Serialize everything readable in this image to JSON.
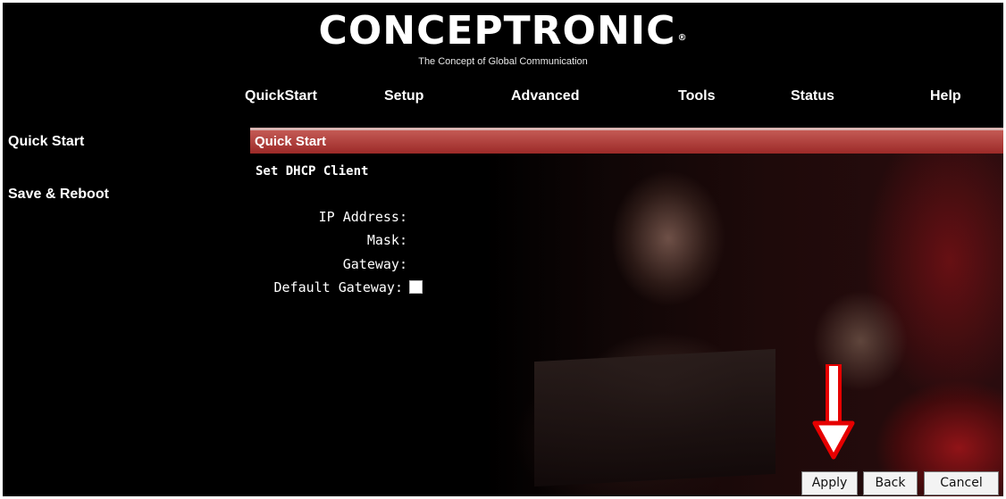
{
  "header": {
    "brand": "CONCEPTRONIC",
    "registered_mark": "®",
    "tagline": "The Concept of Global Communication"
  },
  "nav": {
    "items": [
      {
        "label": "QuickStart"
      },
      {
        "label": "Setup"
      },
      {
        "label": "Advanced"
      },
      {
        "label": "Tools"
      },
      {
        "label": "Status"
      },
      {
        "label": "Help"
      }
    ]
  },
  "sidebar": {
    "items": [
      {
        "label": "Quick Start"
      },
      {
        "label": "Save & Reboot"
      }
    ]
  },
  "main": {
    "section_title": "Quick Start",
    "subtitle": "Set DHCP Client",
    "fields": {
      "ip_address_label": "IP Address:",
      "mask_label": "Mask:",
      "gateway_label": "Gateway:",
      "default_gateway_label": "Default Gateway:",
      "default_gateway_checked": false
    },
    "buttons": {
      "apply": "Apply",
      "back": "Back",
      "cancel": "Cancel"
    }
  },
  "colors": {
    "background": "#000000",
    "section_bar": "#b03a36",
    "text": "#ffffff",
    "annotation_arrow": "#e60000"
  },
  "icons": {
    "annotation": "down-arrow-icon"
  }
}
